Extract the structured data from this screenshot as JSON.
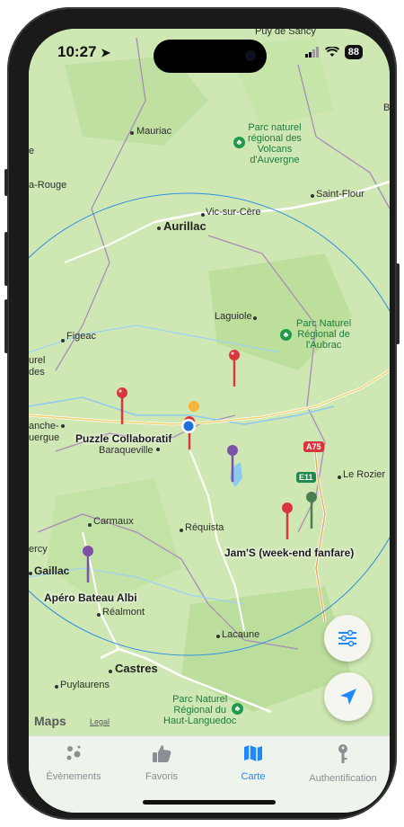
{
  "status_bar": {
    "time": "10:27",
    "battery": "88"
  },
  "map": {
    "places": {
      "puy_de_sancy": "Puy de Sancy",
      "mauriac": "Mauriac",
      "aurillac": "Aurillac",
      "vic_sur_cere": "Vic-sur-Cère",
      "saint_flour": "Saint-Flour",
      "figeac": "Figeac",
      "laguiole": "Laguiole",
      "baraqueville": "Baraqueville",
      "carmaux": "Carmaux",
      "requista": "Réquista",
      "realmont": "Réalmont",
      "gaillac": "Gaillac",
      "lacaune": "Lacaune",
      "castres": "Castres",
      "puylaurens": "Puylaurens",
      "le_rozier": "Le Rozier",
      "edge_e": "e",
      "edge_rouge": "a-Rouge",
      "edge_urel": "urel",
      "edge_des": "des",
      "edge_ache": "anche-",
      "edge_ergue": "uergue",
      "edge_ercy": "ercy",
      "edge_b": "B"
    },
    "parks": {
      "volcans": [
        "Parc naturel",
        "régional des",
        "Volcans",
        "d'Auvergne"
      ],
      "aubrac": [
        "Parc Naturel",
        "Régional de",
        "l'Aubrac"
      ],
      "haut_languedoc": [
        "Parc Naturel",
        "Régional du",
        "Haut-Languedoc"
      ]
    },
    "events": {
      "puzzle": "Puzzle Collaboratif",
      "jams": "Jam'S (week-end fanfare)",
      "apero": "Apéro Bateau Albi"
    },
    "road_badges": {
      "a75": "A75",
      "e11": "E11"
    },
    "pin_colors": {
      "red": "#d9363e",
      "purple": "#7b52a8",
      "green": "#4a7d4f",
      "orange": "#f5b73b"
    },
    "attribution": {
      "logo": "Maps",
      "legal": "Legal"
    }
  },
  "buttons": {
    "filter": "filter-sliders",
    "locate": "location-arrow"
  },
  "tabs": [
    {
      "label": "Évènements",
      "icon": "sparkles-icon",
      "active": false
    },
    {
      "label": "Favoris",
      "icon": "thumbs-up-icon",
      "active": false
    },
    {
      "label": "Carte",
      "icon": "map-icon",
      "active": true
    },
    {
      "label": "Authentification",
      "icon": "key-icon",
      "active": false
    }
  ],
  "colors": {
    "accent": "#1e88ff",
    "tab_inactive": "#8a8f93",
    "map_bg": "#cfe8b3"
  }
}
